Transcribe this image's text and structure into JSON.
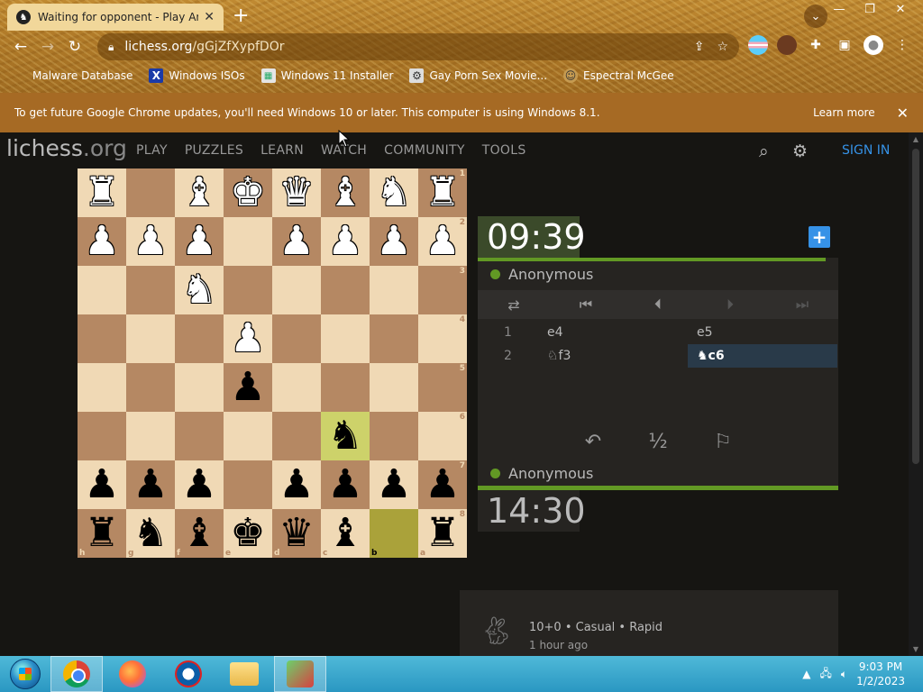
{
  "browser": {
    "tab_title": "Waiting for opponent - Play Anon",
    "url_domain": "lichess.org",
    "url_path": "/gGjZfXypfDOr",
    "bookmarks": [
      {
        "label": "Malware Database",
        "icon": "blank"
      },
      {
        "label": "Windows ISOs",
        "icon": "x"
      },
      {
        "label": "Windows 11 Installer",
        "icon": "win"
      },
      {
        "label": "Gay Porn Sex Movie...",
        "icon": "app"
      },
      {
        "label": "Espectral McGee",
        "icon": "face"
      }
    ],
    "update_message": "To get future Google Chrome updates, you'll need Windows 10 or later. This computer is using Windows 8.1.",
    "update_learn_more": "Learn more"
  },
  "site": {
    "logo_main": "lichess",
    "logo_tld": ".org",
    "nav": [
      "PLAY",
      "PUZZLES",
      "LEARN",
      "WATCH",
      "COMMUNITY",
      "TOOLS"
    ],
    "sign_in": "SIGN IN"
  },
  "board": {
    "orientation": "black",
    "rows": [
      [
        "wR",
        "",
        "wB",
        "wK",
        "wQ",
        "wB",
        "wN",
        "wR"
      ],
      [
        "wP",
        "wP",
        "wP",
        "",
        "wP",
        "wP",
        "wP",
        "wP"
      ],
      [
        "",
        "",
        "wN",
        "",
        "",
        "",
        "",
        ""
      ],
      [
        "",
        "",
        "",
        "wP",
        "",
        "",
        "",
        ""
      ],
      [
        "",
        "",
        "",
        "bP",
        "",
        "",
        "",
        ""
      ],
      [
        "",
        "",
        "",
        "",
        "",
        "bN",
        "",
        ""
      ],
      [
        "bP",
        "bP",
        "bP",
        "",
        "bP",
        "bP",
        "bP",
        "bP"
      ],
      [
        "bR",
        "bN",
        "bB",
        "bK",
        "bQ",
        "bB",
        "",
        "bR"
      ]
    ],
    "highlights": [
      [
        5,
        5
      ],
      [
        7,
        6
      ]
    ],
    "rank_labels": [
      "1",
      "2",
      "3",
      "4",
      "5",
      "6",
      "7",
      "8"
    ],
    "file_labels": [
      "h",
      "g",
      "f",
      "e",
      "d",
      "c",
      "b",
      "a"
    ]
  },
  "game": {
    "clock_top": "09:39",
    "clock_bottom": "14:30",
    "player_top": "Anonymous",
    "player_bottom": "Anonymous",
    "moves": [
      {
        "no": "1",
        "white": "e4",
        "black": "e5"
      },
      {
        "no": "2",
        "white": "♘f3",
        "black": "♞c6"
      }
    ],
    "current_move": {
      "row": 1,
      "side": "black"
    },
    "info_mode": "10+0 • Casual • Rapid",
    "info_ago": "1 hour ago"
  },
  "taskbar": {
    "time": "9:03 PM",
    "date": "1/2/2023"
  }
}
